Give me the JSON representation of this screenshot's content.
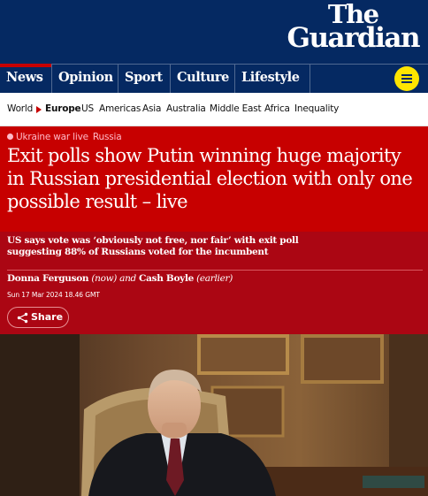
{
  "masthead": {
    "logo_line1": "The",
    "logo_line2": "Guardian"
  },
  "nav": {
    "items": [
      {
        "label": "News",
        "active": true
      },
      {
        "label": "Opinion"
      },
      {
        "label": "Sport"
      },
      {
        "label": "Culture"
      },
      {
        "label": "Lifestyle"
      }
    ],
    "menu_icon": "hamburger-menu-icon"
  },
  "subnav": {
    "items": [
      "World",
      "Europe",
      "US",
      "Americas",
      "Asia",
      "Australia",
      "Middle East",
      "Africa",
      "Inequality"
    ],
    "current": "Europe"
  },
  "article": {
    "kicker_label": "Ukraine war live",
    "kicker_section": "Russia",
    "headline": "Exit polls show Putin winning huge majority in Russian presidential election with only one possible result – live",
    "standfirst": "US says vote was ‘obviously not free, nor fair’ with exit poll suggesting 88% of Russians voted for the incumbent",
    "byline": {
      "author1": "Donna Ferguson",
      "note1": "(now)",
      "conjunction": "and",
      "author2": "Cash Boyle",
      "note2": "(earlier)"
    },
    "dateline": "Sun 17 Mar 2024 18.46 GMT",
    "share_label": "Share"
  },
  "colors": {
    "brand_blue": "#052962",
    "live_red": "#c70000",
    "dark_red": "#ab0613",
    "menu_yellow": "#ffe500"
  }
}
